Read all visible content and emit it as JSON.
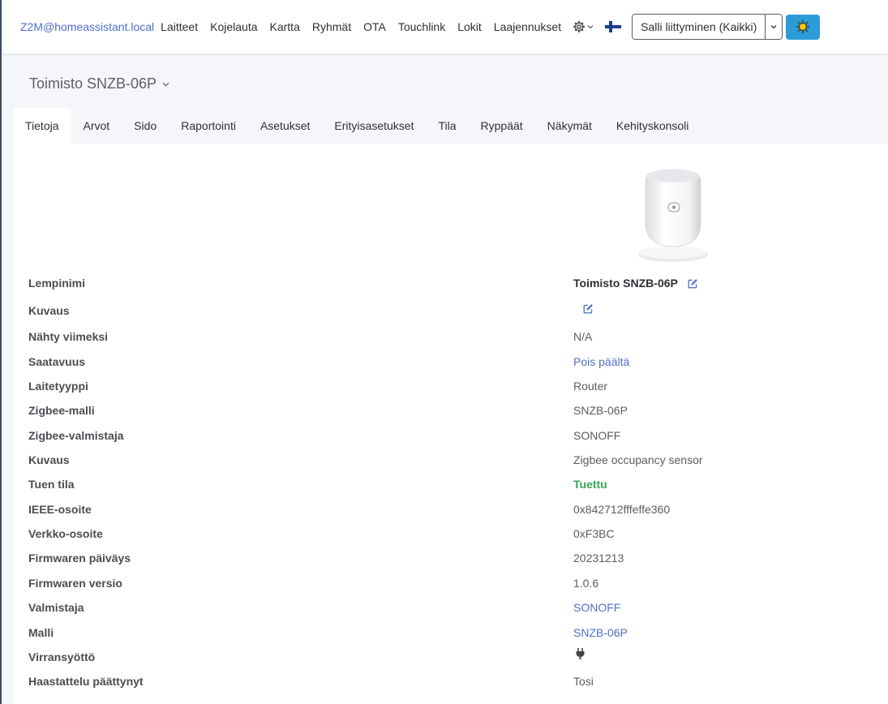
{
  "navbar": {
    "brand": "Z2M@homeassistant.local",
    "items": [
      "Laitteet",
      "Kojelauta",
      "Kartta",
      "Ryhmät",
      "OTA",
      "Touchlink",
      "Lokit",
      "Laajennukset"
    ],
    "gear_icon": "gear-icon",
    "flag_icon": "finland-flag-icon",
    "permit_join_label": "Salli liittyminen (Kaikki)",
    "theme_icon": "sun-icon",
    "accent_color": "#2e9bd9"
  },
  "device": {
    "title": "Toimisto SNZB-06P"
  },
  "tabs": [
    {
      "label": "Tietoja",
      "active": true
    },
    {
      "label": "Arvot"
    },
    {
      "label": "Sido"
    },
    {
      "label": "Raportointi"
    },
    {
      "label": "Asetukset"
    },
    {
      "label": "Erityisasetukset"
    },
    {
      "label": "Tila"
    },
    {
      "label": "Ryppäät"
    },
    {
      "label": "Näkymät"
    },
    {
      "label": "Kehityskonsoli"
    }
  ],
  "info": [
    {
      "label": "Lempinimi",
      "value": "Toimisto SNZB-06P"
    },
    {
      "label": "Kuvaus",
      "value": ""
    },
    {
      "label": "Nähty viimeksi",
      "value": "N/A"
    },
    {
      "label": "Saatavuus",
      "value": "Pois päältä"
    },
    {
      "label": "Laitetyyppi",
      "value": "Router"
    },
    {
      "label": "Zigbee-malli",
      "value": "SNZB-06P"
    },
    {
      "label": "Zigbee-valmistaja",
      "value": "SONOFF"
    },
    {
      "label": "Kuvaus",
      "value": "Zigbee occupancy sensor"
    },
    {
      "label": "Tuen tila",
      "value": "Tuettu"
    },
    {
      "label": "IEEE-osoite",
      "value": "0x842712fffeffe360"
    },
    {
      "label": "Verkko-osoite",
      "value": "0xF3BC"
    },
    {
      "label": "Firmwaren päiväys",
      "value": "20231213"
    },
    {
      "label": "Firmwaren versio",
      "value": "1.0.6"
    },
    {
      "label": "Valmistaja",
      "value": "SONOFF"
    },
    {
      "label": "Malli",
      "value": "SNZB-06P"
    },
    {
      "label": "Virransyöttö",
      "value": "",
      "icon": "plug-icon"
    },
    {
      "label": "Haastattelu päättynyt",
      "value": "Tosi"
    }
  ]
}
